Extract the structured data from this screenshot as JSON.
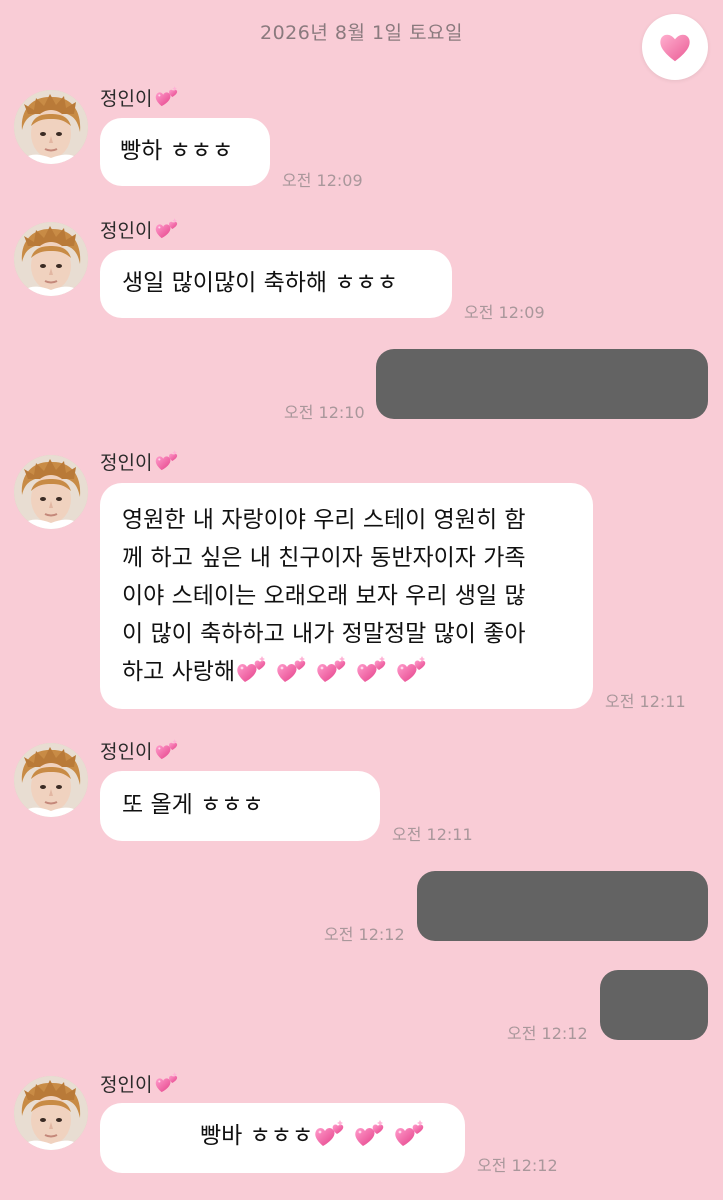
{
  "date_header": "2026년 8월 1일 토요일",
  "heart_button_icon": "heart-icon",
  "sender_name": "정인이",
  "sender_emoji": "two-hearts-emoji",
  "messages": [
    {
      "dir": "in",
      "text": "빵하 ㅎㅎㅎ",
      "time": "오전 12:09"
    },
    {
      "dir": "in",
      "text": "생일 많이많이 축하해 ㅎㅎㅎ",
      "time": "오전 12:09"
    },
    {
      "dir": "out",
      "text": "",
      "time": "오전 12:10",
      "note": "redacted"
    },
    {
      "dir": "in",
      "lines": [
        "영원한 내 자랑이야 우리 스테이 영원히 함",
        "께 하고 싶은 내 친구이자 동반자이자 가족",
        "이야 스테이는 오래오래 보자 우리 생일 많",
        "이 많이 축하하고 내가 정말정말 많이 좋아",
        "하고 사랑해"
      ],
      "trailing_emoji_count": 5,
      "time": "오전 12:11"
    },
    {
      "dir": "in",
      "text": "또 올게 ㅎㅎㅎ",
      "time": "오전 12:11"
    },
    {
      "dir": "out",
      "text": "",
      "time": "오전 12:12",
      "note": "redacted"
    },
    {
      "dir": "out",
      "text": "",
      "time": "오전 12:12",
      "note": "redacted"
    },
    {
      "dir": "in",
      "text": "빵바 ㅎㅎㅎ",
      "trailing_emoji_count": 3,
      "time": "오전 12:12"
    }
  ],
  "colors": {
    "background": "#f9ccd6",
    "bubble_in": "#ffffff",
    "bubble_out_redacted": "#636363",
    "timestamp": "#a9979b",
    "heart": "#f06fa0"
  }
}
